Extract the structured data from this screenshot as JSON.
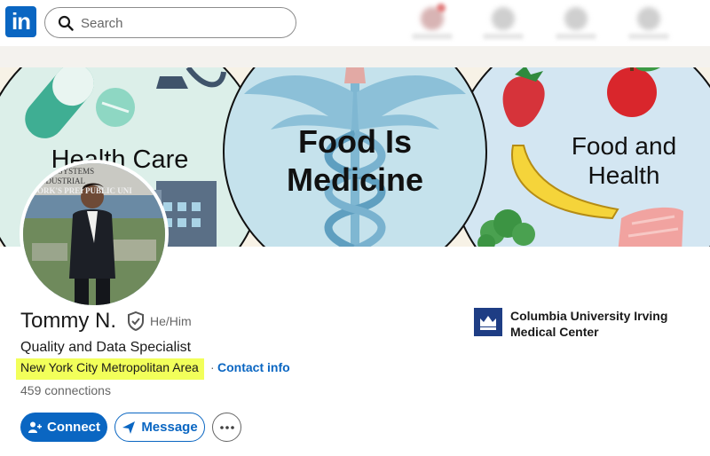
{
  "nav": {
    "logo_text": "in",
    "search": {
      "placeholder": "Search"
    }
  },
  "banner": {
    "left_title": "Health Care",
    "center_title_line1": "Food Is",
    "center_title_line2": "Medicine",
    "right_title_line1": "Food and",
    "right_title_line2": "Health",
    "colors": {
      "left_circle": "#dcefe9",
      "center_circle": "#c5e2ec",
      "right_circle": "#d3e6f2",
      "caduceus": "#7fb7d2"
    }
  },
  "avatar_text": {
    "line1": "ITON",
    "line2": "SYSTEMS",
    "line3": "INDUSTRIAL",
    "line4": "ORK'S PREI",
    "line5": "PUBLIC UNI"
  },
  "profile": {
    "name": "Tommy N.",
    "pronouns": "He/Him",
    "headline": "Quality and Data Specialist",
    "location": "New York City Metropolitan Area",
    "separator": "·",
    "contact_label": "Contact info",
    "connections": "459 connections",
    "company": {
      "name_line1": "Columbia University Irving",
      "name_line2": "Medical Center"
    }
  },
  "actions": {
    "connect_label": "Connect",
    "message_label": "Message",
    "more_icon": "more-horizontal-icon"
  },
  "colors": {
    "brand": "#0a66c2",
    "highlight": "#f2ff5a"
  }
}
